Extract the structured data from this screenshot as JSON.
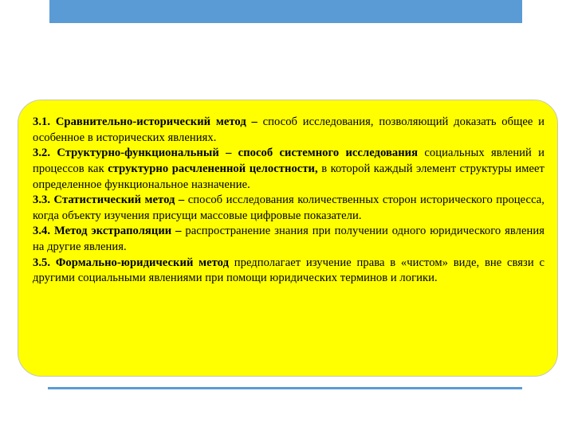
{
  "slide": {
    "title": "",
    "colors": {
      "header_bar": "#5B9BD5",
      "panel_fill": "#FFFF00",
      "panel_border": "#C8C8B4",
      "footer_rule": "#5B9BD5",
      "text": "#000000"
    }
  },
  "content": {
    "methods": [
      {
        "number": "3.1.",
        "term": "Сравнительно-исторический метод",
        "dash": " – ",
        "body_before": "способ исследования, позволяющий доказать общее и особенное в исторических явлениях.",
        "emphasis": "",
        "body_after": ""
      },
      {
        "number": "3.2.",
        "term": "Структурно-функциональный",
        "dash": " – ",
        "body_before": "",
        "bold_lead": "способ системного исследования",
        "middle": " социальных явлений и процессов как ",
        "emphasis": "структурно расчлененной целостности,",
        "body_after": " в которой каждый элемент структуры имеет определенное функциональное назначение."
      },
      {
        "number": "3.3.",
        "term": "Статистический метод",
        "dash": " – ",
        "body_before": "способ исследования количественных сторон исторического процесса, когда объекту изучения присущи массовые цифровые показатели.",
        "emphasis": "",
        "body_after": ""
      },
      {
        "number": "3.4.",
        "term": "Метод экстраполяции",
        "dash": " – ",
        "body_before": "распространение знания при получении одного юридического явления на другие явления.",
        "emphasis": "",
        "body_after": ""
      },
      {
        "number": "3.5.",
        "term": "Формально-юридический метод",
        "dash": " ",
        "body_before": "предполагает изучение права в «чистом» виде, вне связи с другими социальными явлениями при помощи юридических терминов и логики.",
        "emphasis": "",
        "body_after": ""
      }
    ]
  }
}
